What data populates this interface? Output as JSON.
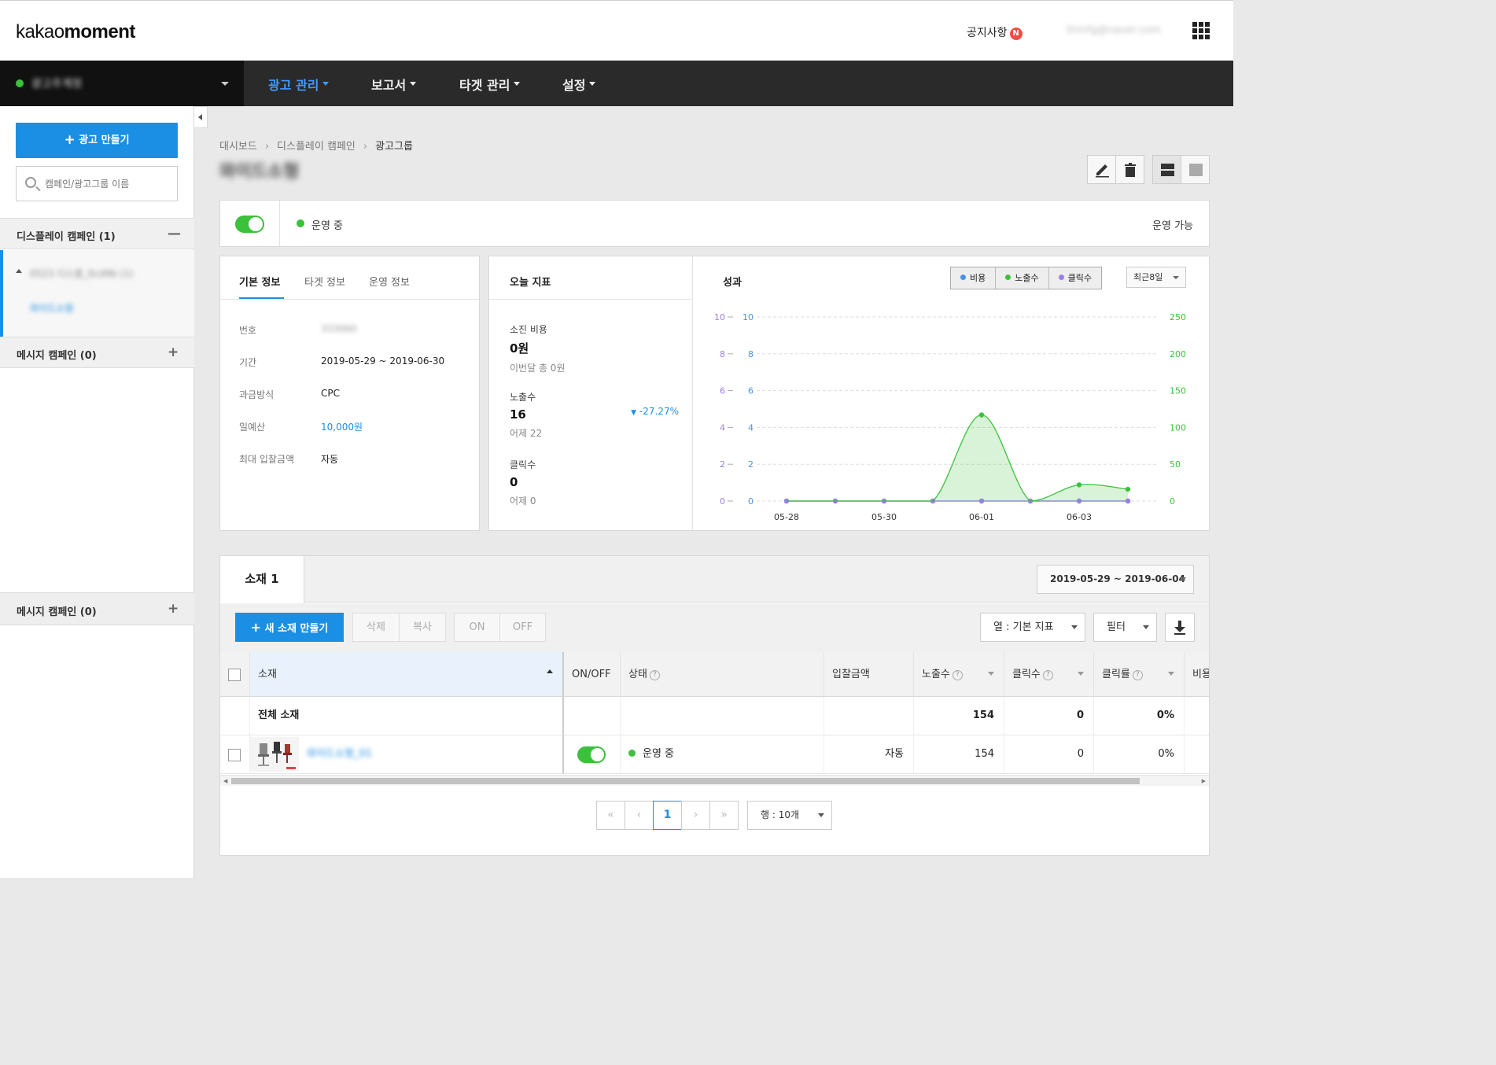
{
  "header": {
    "logo_light": "kakao",
    "logo_bold": "moment",
    "notice": "공지사항",
    "notice_badge": "N",
    "user_email": "thmfg@naver.com"
  },
  "nav": {
    "account_name": "광고주계정",
    "menus": [
      "광고 관리",
      "보고서",
      "타겟 관리",
      "설정"
    ]
  },
  "sidebar": {
    "create_label": "광고 만들기",
    "search_placeholder": "캠페인/광고그룹 이름",
    "display_section": "디스플레이 캠페인 (1)",
    "campaign_name": "0523 디스플_0cd9b (1)",
    "adgroup_name": "와이드소형",
    "message_section": "메시지 캠페인 (0)",
    "message_section_dup": "메시지 캠페인 (0)"
  },
  "breadcrumb": [
    "대시보드",
    "디스플레이 캠페인",
    "광고그룹"
  ],
  "page_title": "와이드소형",
  "status": {
    "state": "운영 중",
    "availability": "운영 가능"
  },
  "info": {
    "tabs": [
      "기본 정보",
      "타겟 정보",
      "운영 정보"
    ],
    "rows": [
      {
        "k": "번호",
        "v": "333060"
      },
      {
        "k": "기간",
        "v": "2019-05-29 ~ 2019-06-30"
      },
      {
        "k": "과금방식",
        "v": "CPC"
      },
      {
        "k": "일예산",
        "v": "10,000원"
      },
      {
        "k": "최대 입찰금액",
        "v": "자동"
      }
    ]
  },
  "today": {
    "title": "오늘 지표",
    "spend_label": "소진 비용",
    "spend_value": "0원",
    "spend_sub": "이번달 총 0원",
    "imp_label": "노출수",
    "imp_value": "16",
    "imp_change": "-27.27%",
    "imp_sub": "어제 22",
    "click_label": "클릭수",
    "click_value": "0",
    "click_sub": "어제 0"
  },
  "performance": {
    "title": "성과",
    "legend": [
      "비용",
      "노출수",
      "클릭수"
    ],
    "range": "최근8일"
  },
  "colors": {
    "accent": "#1a8fe3",
    "green": "#3bc13b",
    "cost": "#4a90e2",
    "imp": "#3bc13b",
    "click": "#9b7fe6"
  },
  "chart_data": {
    "type": "line",
    "title": "성과",
    "x": [
      "05-28",
      "05-29",
      "05-30",
      "05-31",
      "06-01",
      "06-02",
      "06-03",
      "06-04"
    ],
    "x_ticks": [
      "05-28",
      "05-30",
      "06-01",
      "06-03"
    ],
    "series": [
      {
        "name": "비용",
        "axis": "left_outer",
        "values": [
          0,
          0,
          0,
          0,
          0,
          0,
          0,
          0
        ]
      },
      {
        "name": "클릭수",
        "axis": "left_inner",
        "values": [
          0,
          0,
          0,
          0,
          0,
          0,
          0,
          0
        ]
      },
      {
        "name": "노출수",
        "axis": "right",
        "values": [
          0,
          0,
          0,
          0,
          117,
          0,
          22,
          16
        ]
      }
    ],
    "y_left_ticks": [
      0,
      2,
      4,
      6,
      8,
      10
    ],
    "y_right_ticks": [
      0,
      50,
      100,
      150,
      200,
      250
    ],
    "ylim_left": [
      0,
      10
    ],
    "ylim_right": [
      0,
      250
    ],
    "grid": true
  },
  "creatives": {
    "tab": "소재 1",
    "date_range": "2019-05-29 ~ 2019-06-04",
    "new_btn": "새 소재 만들기",
    "delete_btn": "삭제",
    "copy_btn": "복사",
    "on_btn": "ON",
    "off_btn": "OFF",
    "col_select": "열 : 기본 지표",
    "filter": "필터",
    "headers": [
      "소재",
      "ON/OFF",
      "상태",
      "입찰금액",
      "노출수",
      "클릭수",
      "클릭률",
      "비용"
    ],
    "total_row": {
      "label": "전체 소재",
      "imp": "154",
      "click": "0",
      "ctr": "0%"
    },
    "row": {
      "name": "와이드소형_01",
      "status": "운영 중",
      "bid": "자동",
      "imp": "154",
      "click": "0",
      "ctr": "0%"
    },
    "page": "1",
    "rows_per_page": "행 : 10개"
  }
}
